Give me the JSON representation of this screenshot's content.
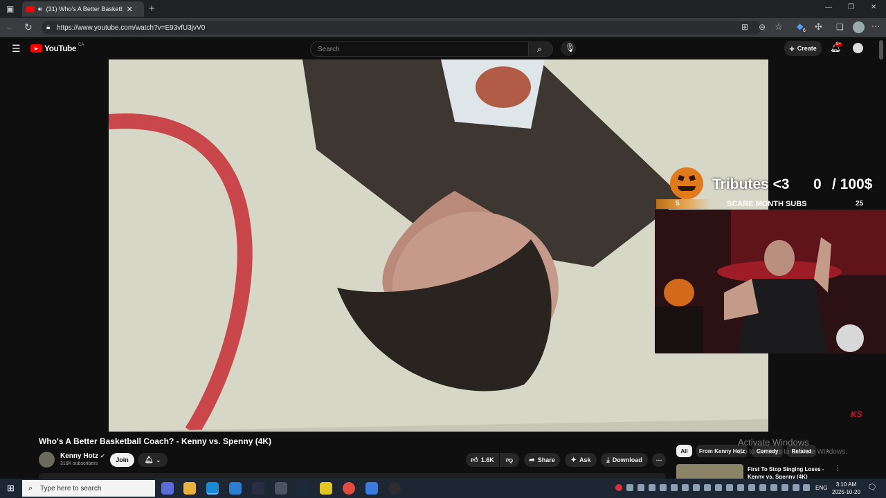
{
  "browser": {
    "tab_title": "(31) Who's A Better Basketb",
    "url": "https://www.youtube.com/watch?v=E93vfU3jvV0",
    "extension_badge": "6"
  },
  "youtube": {
    "logo_text": "YouTube",
    "region": "CA",
    "search_placeholder": "Search",
    "create_label": "Create",
    "notif_count": "9+"
  },
  "overlay": {
    "tributes_label": "Tributes <3",
    "tributes_amount": "0",
    "tributes_goal": "/ 100$",
    "subs_left": "5",
    "subs_label": "SCARE MONTH SUBS",
    "subs_right": "25",
    "ks_logo": "KS"
  },
  "video": {
    "title": "Who's A Better Basketball Coach? - Kenny vs. Spenny (4K)",
    "channel": "Kenny Hotz",
    "subscribers": "316K subscribers",
    "join_label": "Join",
    "likes": "1.6K",
    "share_label": "Share",
    "ask_label": "Ask",
    "download_label": "Download"
  },
  "sidebar": {
    "chips": [
      "All",
      "From Kenny Hotz",
      "Comedy",
      "Related"
    ],
    "next_title_1": "First To Stop Singing Loses -",
    "next_title_2": "Kenny vs. Spenny (4K)"
  },
  "watermark": {
    "line1": "Activate Windows",
    "line2": "Go to Settings to activate Windows."
  },
  "taskbar": {
    "search_placeholder": "Type here to search",
    "lang": "ENG",
    "time": "3:10 AM",
    "date": "2025-10-20"
  },
  "colors": {
    "youtube_red": "#ff0000",
    "overlay_orange": "#e07a1a",
    "taskbar": "#1c2733"
  }
}
